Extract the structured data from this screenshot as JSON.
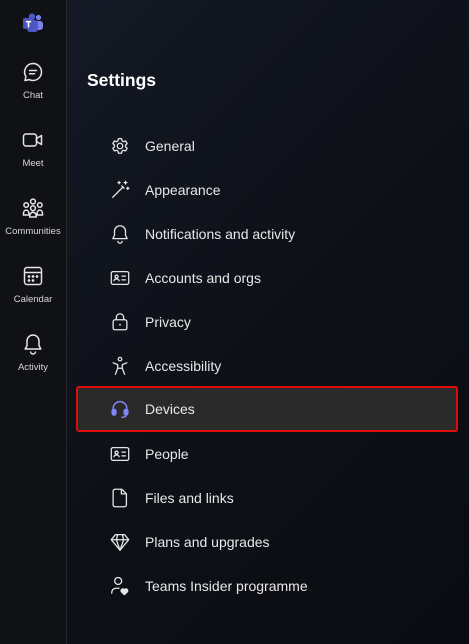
{
  "app": {
    "logo_icon": "microsoft-teams-logo-icon",
    "accent_color": "#7f85f5",
    "selection_outline_color": "#e00b0b"
  },
  "rail": {
    "items": [
      {
        "label": "Chat",
        "icon": "chat-icon"
      },
      {
        "label": "Meet",
        "icon": "video-camera-icon"
      },
      {
        "label": "Communities",
        "icon": "communities-icon"
      },
      {
        "label": "Calendar",
        "icon": "calendar-icon"
      },
      {
        "label": "Activity",
        "icon": "bell-icon"
      }
    ]
  },
  "settings": {
    "title": "Settings",
    "selected_item": "Devices",
    "items": [
      {
        "label": "General",
        "icon": "gear-icon"
      },
      {
        "label": "Appearance",
        "icon": "magic-wand-icon"
      },
      {
        "label": "Notifications and activity",
        "icon": "bell-icon"
      },
      {
        "label": "Accounts and orgs",
        "icon": "contact-card-icon"
      },
      {
        "label": "Privacy",
        "icon": "lock-icon"
      },
      {
        "label": "Accessibility",
        "icon": "accessibility-icon"
      },
      {
        "label": "Devices",
        "icon": "headset-icon"
      },
      {
        "label": "People",
        "icon": "contact-card-icon"
      },
      {
        "label": "Files and links",
        "icon": "document-icon"
      },
      {
        "label": "Plans and upgrades",
        "icon": "diamond-icon"
      },
      {
        "label": "Teams Insider programme",
        "icon": "person-heart-icon"
      }
    ]
  }
}
